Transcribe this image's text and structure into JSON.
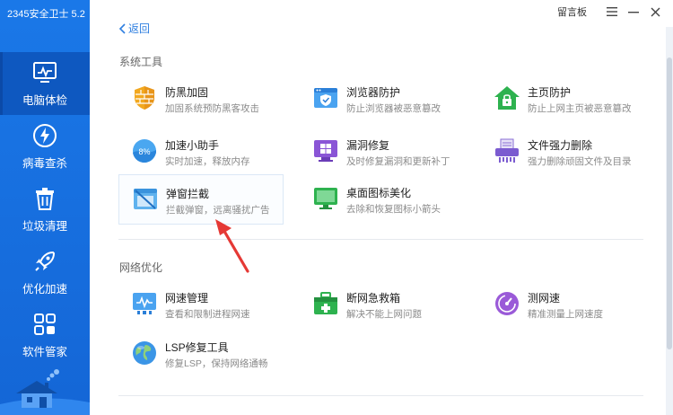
{
  "app_title": "2345安全卫士 5.2",
  "window": {
    "message_board": "留言板"
  },
  "back_label": "返回",
  "sidebar": {
    "items": [
      {
        "label": "电脑体检",
        "icon": "monitor-icon",
        "active": true
      },
      {
        "label": "病毒查杀",
        "icon": "lightning-icon",
        "active": false
      },
      {
        "label": "垃圾清理",
        "icon": "trash-icon",
        "active": false
      },
      {
        "label": "优化加速",
        "icon": "rocket-icon",
        "active": false
      },
      {
        "label": "软件管家",
        "icon": "apps-icon",
        "active": false
      }
    ]
  },
  "sections": [
    {
      "title": "系统工具",
      "tools": [
        {
          "name": "防黑加固",
          "desc": "加固系统预防黑客攻击",
          "icon": "shield-wall-icon"
        },
        {
          "name": "浏览器防护",
          "desc": "防止浏览器被恶意篡改",
          "icon": "browser-shield-icon"
        },
        {
          "name": "主页防护",
          "desc": "防止上网主页被恶意篡改",
          "icon": "home-lock-icon"
        },
        {
          "name": "加速小助手",
          "desc": "实时加速，释放内存",
          "icon": "speed-ball-icon"
        },
        {
          "name": "漏洞修复",
          "desc": "及时修复漏洞和更新补丁",
          "icon": "windows-patch-icon"
        },
        {
          "name": "文件强力删除",
          "desc": "强力删除顽固文件及目录",
          "icon": "shredder-icon"
        },
        {
          "name": "弹窗拦截",
          "desc": "拦截弹窗，远离骚扰广告",
          "icon": "popup-block-icon"
        },
        {
          "name": "桌面图标美化",
          "desc": "去除和恢复图标小箭头",
          "icon": "desktop-icon"
        }
      ]
    },
    {
      "title": "网络优化",
      "tools": [
        {
          "name": "网速管理",
          "desc": "查看和限制进程网速",
          "icon": "network-monitor-icon"
        },
        {
          "name": "断网急救箱",
          "desc": "解决不能上网问题",
          "icon": "first-aid-icon"
        },
        {
          "name": "测网速",
          "desc": "精准测量上网速度",
          "icon": "speedometer-icon"
        },
        {
          "name": "LSP修复工具",
          "desc": "修复LSP，保持网络通畅",
          "icon": "globe-icon"
        }
      ]
    }
  ],
  "colors": {
    "sidebar": "#1a78e8",
    "accent": "#2f7fe0",
    "annotation": "#e53935"
  }
}
